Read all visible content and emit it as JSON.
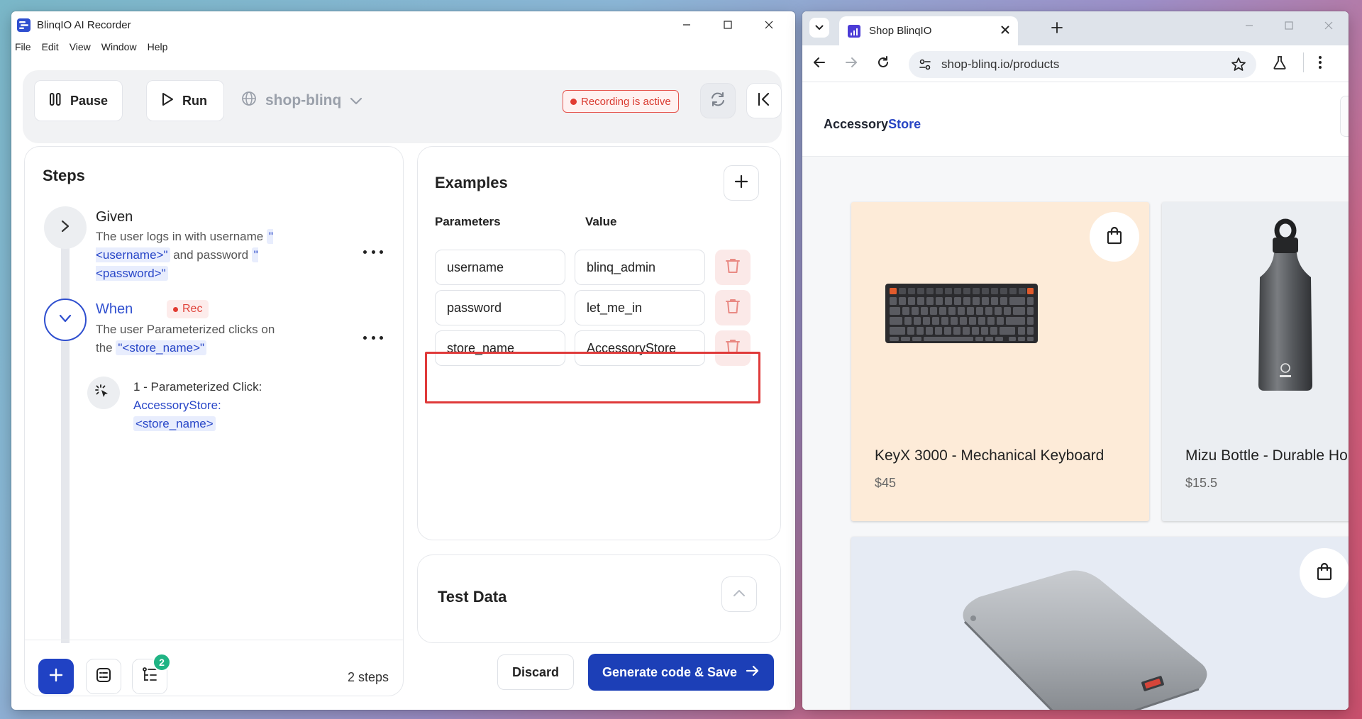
{
  "recorder": {
    "title": "BlinqIO AI Recorder",
    "menu": [
      "File",
      "Edit",
      "View",
      "Window",
      "Help"
    ],
    "toolbar": {
      "pause_label": "Pause",
      "run_label": "Run",
      "environment": "shop-blinq",
      "recording_status": "Recording is active"
    },
    "steps": {
      "heading": "Steps",
      "given": {
        "keyword": "Given",
        "text_before": "The user logs in with username ",
        "param1": "\"<username>\"",
        "text_middle": " and password ",
        "param2": "\"<password>\""
      },
      "when": {
        "keyword": "When",
        "rec_tag": "Rec",
        "text": "The user Parameterized clicks on the ",
        "param": "\"<store_name>\""
      },
      "sub_step": {
        "label": "1 - Parameterized Click:",
        "value": "AccessoryStore:",
        "param": "<store_name>"
      },
      "badge_count": "2",
      "count_label": "2 steps"
    },
    "examples": {
      "title": "Examples",
      "col_parameters": "Parameters",
      "col_value": "Value",
      "rows": [
        {
          "param": "username",
          "value": "blinq_admin"
        },
        {
          "param": "password",
          "value": "let_me_in"
        },
        {
          "param": "store_name",
          "value": "AccessoryStore"
        }
      ]
    },
    "test_data": {
      "title": "Test Data"
    },
    "actions": {
      "discard_label": "Discard",
      "generate_label": "Generate code & Save"
    }
  },
  "browser": {
    "tab_title": "Shop BlinqIO",
    "url": "shop-blinq.io/products",
    "site": {
      "logo_part1": "Accessory",
      "logo_part2": "Store",
      "products": [
        {
          "name": "KeyX 3000 - Mechanical Keyboard",
          "price": "$45"
        },
        {
          "name": "Mizu Bottle - Durable Ho",
          "price": "$15.5"
        }
      ]
    }
  },
  "colors": {
    "primary": "#1c3fb7",
    "recording_red": "#e23c32",
    "badge_green": "#20b484",
    "card_keyboard_bg": "#fdebd8"
  }
}
